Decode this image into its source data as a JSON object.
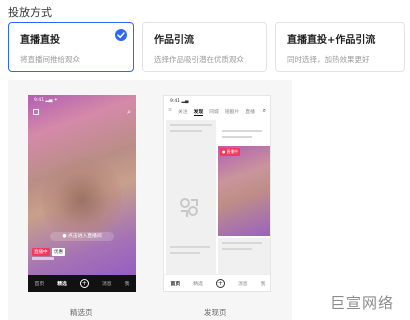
{
  "section": {
    "title": "投放方式"
  },
  "options": [
    {
      "title": "直播直投",
      "desc": "将直播间推给观众",
      "selected": true
    },
    {
      "title": "作品引流",
      "desc": "选择作品吸引潜在优质观众",
      "selected": false
    },
    {
      "title": "直播直投+作品引流",
      "desc": "同时选择，加热效果更好",
      "selected": false
    }
  ],
  "colors": {
    "accent": "#2a6bf2",
    "live_red": "#f23b5c"
  },
  "preview": {
    "phone1": {
      "status": "9:41 ▂▄ ✦",
      "live_pill": "● 点击进入直播间",
      "tag1": "直播中",
      "tag2": "优惠",
      "nav": [
        "首页",
        "精选",
        "+",
        "消息",
        "我"
      ],
      "label": "精选页"
    },
    "phone2": {
      "status": "9:41 ▂▄",
      "tabs": [
        "≡",
        "关注",
        "发现",
        "同城",
        "短剧片",
        "直播"
      ],
      "live_tag": "● 直播中",
      "nav": [
        "首页",
        "精选",
        "+",
        "消息",
        "我"
      ],
      "label": "发现页"
    }
  },
  "watermark": {
    "text": "巨宣网络"
  }
}
